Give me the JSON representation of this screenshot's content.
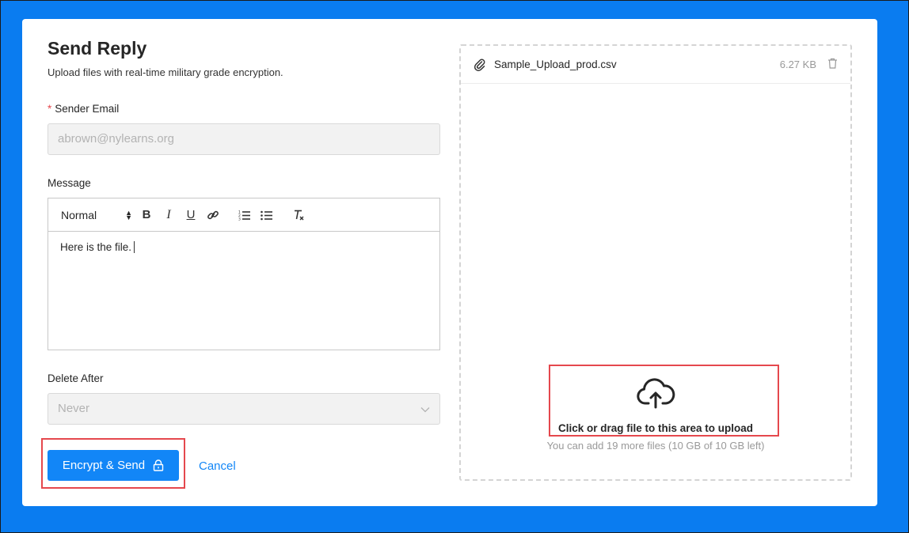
{
  "form": {
    "title": "Send Reply",
    "subtitle": "Upload files with real-time military grade encryption.",
    "sender_email": {
      "required_mark": "*",
      "label": "Sender Email",
      "value": "abrown@nylearns.org"
    },
    "message": {
      "label": "Message",
      "toolbar": {
        "format_select": "Normal",
        "bold": "B",
        "italic": "I",
        "underline": "U"
      },
      "body": "Here is the file."
    },
    "delete_after": {
      "label": "Delete After",
      "value": "Never"
    },
    "actions": {
      "submit_label": "Encrypt & Send",
      "cancel_label": "Cancel"
    }
  },
  "upload": {
    "files": [
      {
        "name": "Sample_Upload_prod.csv",
        "size": "6.27 KB"
      }
    ],
    "dropzone_title": "Click or drag file to this area to upload",
    "dropzone_hint": "You can add 19 more files (10 GB of 10 GB left)"
  },
  "colors": {
    "background": "#0a7cf0",
    "primary": "#1286f7",
    "highlight": "#e5484d"
  },
  "icons": {
    "attachment": "paperclip-icon",
    "delete": "trash-icon",
    "upload": "cloud-upload-icon",
    "lock": "lock-icon"
  }
}
